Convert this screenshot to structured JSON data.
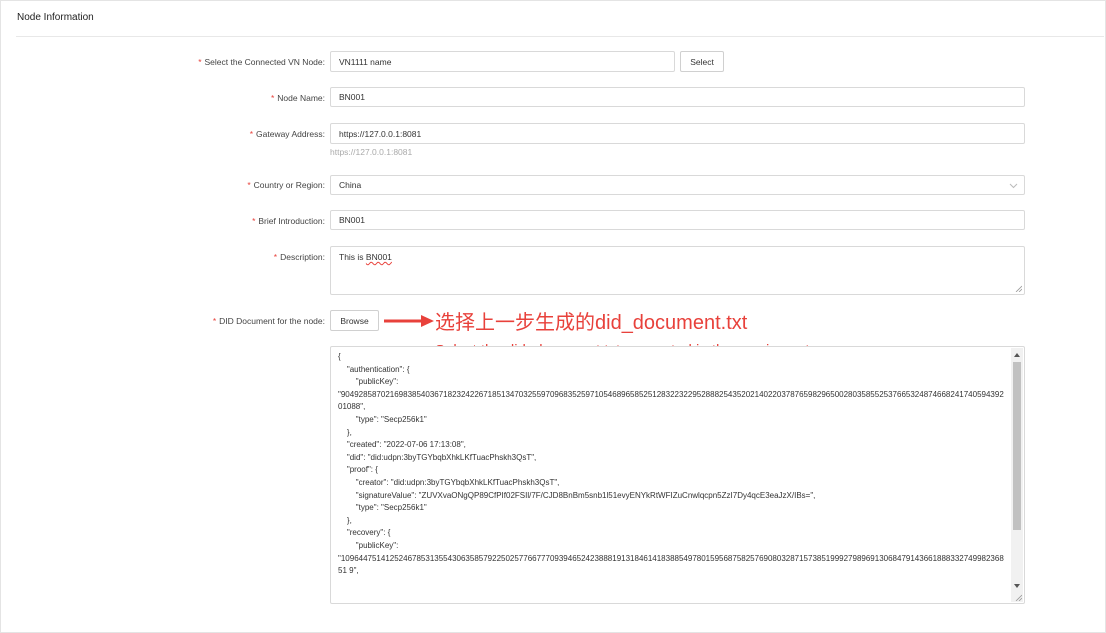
{
  "section_title": "Node Information",
  "fields": {
    "vn_node": {
      "label": "Select the Connected VN Node:",
      "value": "VN1111 name",
      "button": "Select"
    },
    "node_name": {
      "label": "Node Name:",
      "value": "BN001"
    },
    "gateway": {
      "label": "Gateway Address:",
      "value": "https://127.0.0.1:8081",
      "hint": "https://127.0.0.1:8081"
    },
    "country": {
      "label": "Country or Region:",
      "value": "China"
    },
    "brief": {
      "label": "Brief Introduction:",
      "value": "BN001"
    },
    "description": {
      "label": "Description:",
      "value_prefix": "This is ",
      "value_underlined": "BN001"
    },
    "did": {
      "label": "DID Document for the node:",
      "button": "Browse"
    }
  },
  "required_mark": "*",
  "annotation": {
    "chinese": "选择上一步生成的did_document.txt",
    "english": "Select the did_document.txt generated in the previous step"
  },
  "did_json_lines": [
    "{",
    "    \"authentication\": {",
    "        \"publicKey\":",
    "\"9049285870216983854036718232422671851347032559709683525971054689658525128322322952888254352021402203787659829650028035855253766532487466824174059439201088\",",
    "        \"type\": \"Secp256k1\"",
    "    },",
    "    \"created\": \"2022-07-06 17:13:08\",",
    "    \"did\": \"did:udpn:3byTGYbqbXhkLKfTuacPhskh3QsT\",",
    "    \"proof\": {",
    "        \"creator\": \"did:udpn:3byTGYbqbXhkLKfTuacPhskh3QsT\",",
    "        \"signatureValue\": \"ZUVXvaONgQP89CfPIf02FSIl/7F/CJD8BnBm5snb1l51evyENYkRtWFIZuCnwlqcpn5ZzI7Dy4qcE3eaJzX/IBs=\",",
    "        \"type\": \"Secp256k1\"",
    "    },",
    "    \"recovery\": {",
    "        \"publicKey\":",
    "\"1096447514125246785313554306358579225025776677709394652423888191318461418388549780159568758257690803287157385199927989691306847914366188833274998236851 9\","
  ],
  "colors": {
    "required": "#e8413b",
    "annotation": "#e8413b",
    "border": "#d9d9d9"
  },
  "icons": {
    "dropdown": "chevron-down-icon",
    "arrow": "arrow-right-icon",
    "resize": "resize-handle-icon"
  }
}
